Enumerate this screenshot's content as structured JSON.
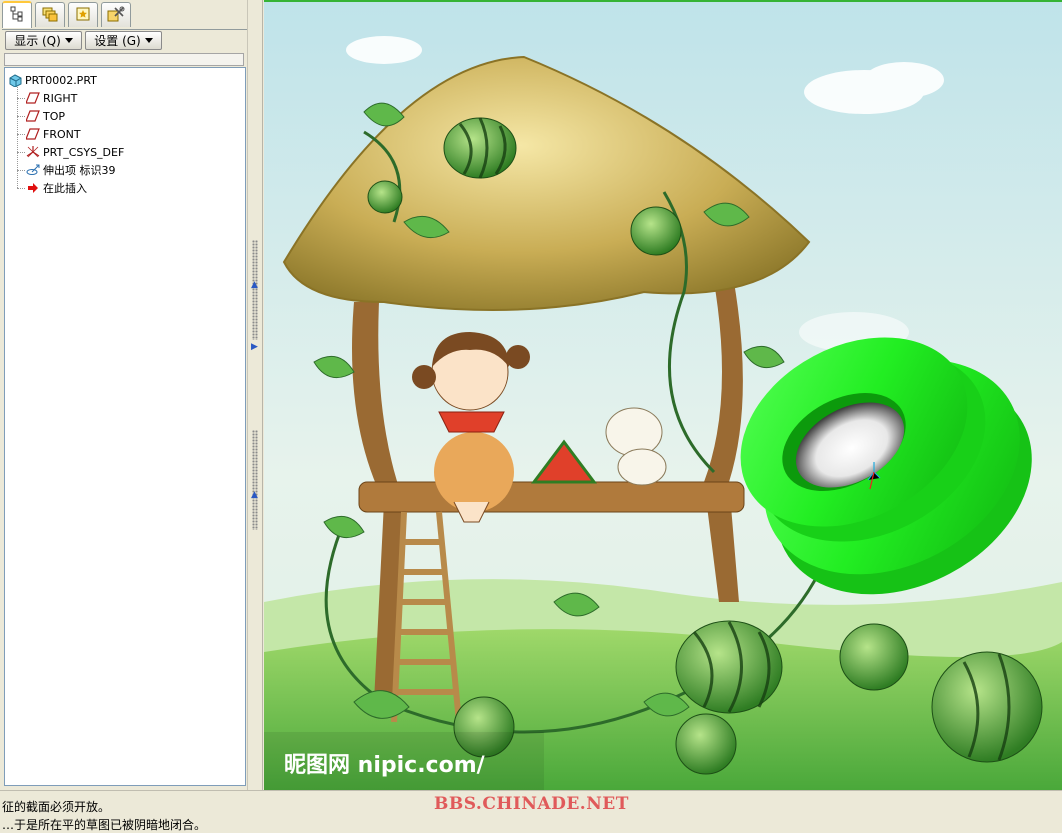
{
  "tabs": [
    {
      "icon": "model-tree-icon"
    },
    {
      "icon": "layers-icon"
    },
    {
      "icon": "favorites-icon"
    },
    {
      "icon": "tools-icon"
    }
  ],
  "toolbar": {
    "show_label": "显示 (Q)",
    "settings_label": "设置 (G)"
  },
  "tree": {
    "root": "PRT0002.PRT",
    "items": [
      {
        "label": "RIGHT",
        "icon": "datum-plane-icon"
      },
      {
        "label": "TOP",
        "icon": "datum-plane-icon"
      },
      {
        "label": "FRONT",
        "icon": "datum-plane-icon"
      },
      {
        "label": "PRT_CSYS_DEF",
        "icon": "coordinate-system-icon"
      },
      {
        "label": "伸出项  标识39",
        "icon": "protrusion-icon"
      },
      {
        "label": "在此插入",
        "icon": "insert-here-arrow-icon"
      }
    ]
  },
  "graphics": {
    "watermark_text": "昵图网 nipic.com/",
    "model_color": "#22ee22"
  },
  "messages": {
    "line1": "征的截面必须开放。",
    "line2": "…于是所在平的草图已被阴暗地闭合。",
    "site_watermark": "BBS.CHINADE.NET"
  }
}
